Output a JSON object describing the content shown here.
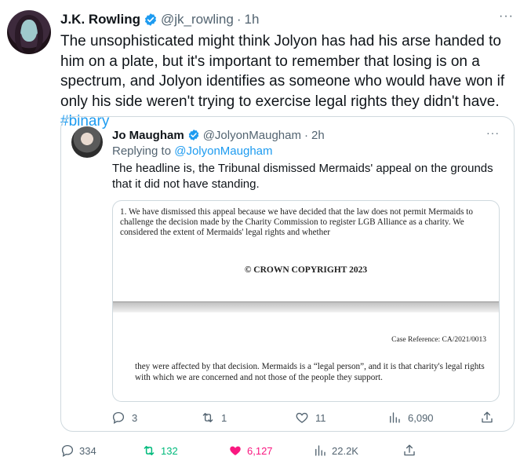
{
  "tweet": {
    "author_name": "J.K. Rowling",
    "author_handle": "@jk_rowling",
    "separator": "·",
    "time": "1h",
    "more": "···",
    "text_main": "The unsophisticated might think Jolyon has had his arse handed to him on a plate, but it's important to remember that losing is on a spectrum, and Jolyon identifies as someone who would have won if only his side weren't trying to exercise legal rights they didn't have. ",
    "hashtag": "#binary",
    "actions": {
      "replies": "334",
      "retweets": "132",
      "likes": "6,127",
      "views": "22.2K"
    }
  },
  "quoted": {
    "author_name": "Jo Maugham",
    "author_handle": "@JolyonMaugham",
    "separator": "·",
    "time": "2h",
    "more": "···",
    "replying_prefix": "Replying to ",
    "replying_to": "@JolyonMaugham",
    "text": "The headline is, the Tribunal dismissed Mermaids' appeal on the grounds that it did not have standing.",
    "document": {
      "paragraph1": "1.  We have dismissed this appeal because we have decided that the law does not permit Mermaids to challenge the decision made by the Charity Commission to register LGB Alliance as a charity. We considered the extent of Mermaids' legal rights and whether",
      "copyright": "© CROWN COPYRIGHT 2023",
      "case_reference": "Case Reference: CA/2021/0013",
      "paragraph2": "they were affected by that decision. Mermaids is a “legal person”, and it is that charity's legal rights with which we are concerned and not those of the people they support."
    },
    "actions": {
      "replies": "3",
      "retweets": "1",
      "likes": "11",
      "views": "6,090"
    }
  },
  "colors": {
    "verified": "#1d9bf0",
    "link": "#1d9bf0",
    "retweet_active": "#00ba7c",
    "like_active": "#f91880",
    "muted": "#536471"
  },
  "icons": [
    "verified-badge-icon",
    "more-icon",
    "reply-icon",
    "retweet-icon",
    "like-icon",
    "views-icon",
    "share-icon"
  ]
}
